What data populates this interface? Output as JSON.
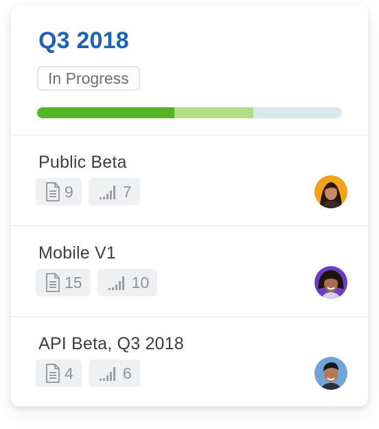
{
  "milestone": {
    "title": "Q3 2018",
    "status": "In Progress",
    "progress": {
      "done": 0.45,
      "in_progress": 0.26
    },
    "colors": {
      "title": "#1b63b8",
      "done": "#55b524",
      "in_progress": "#b4dc87",
      "remaining": "#dbe7ee"
    }
  },
  "items": [
    {
      "title": "Public Beta",
      "docs": "9",
      "points": "7",
      "avatar_color": "#f0a21a"
    },
    {
      "title": "Mobile V1",
      "docs": "15",
      "points": "10",
      "avatar_color": "#6b3fc4"
    },
    {
      "title": "API Beta, Q3 2018",
      "docs": "4",
      "points": "6",
      "avatar_color": "#6fa3da"
    }
  ],
  "icons": {
    "docs": "document-icon",
    "points": "bar-chart-icon"
  }
}
